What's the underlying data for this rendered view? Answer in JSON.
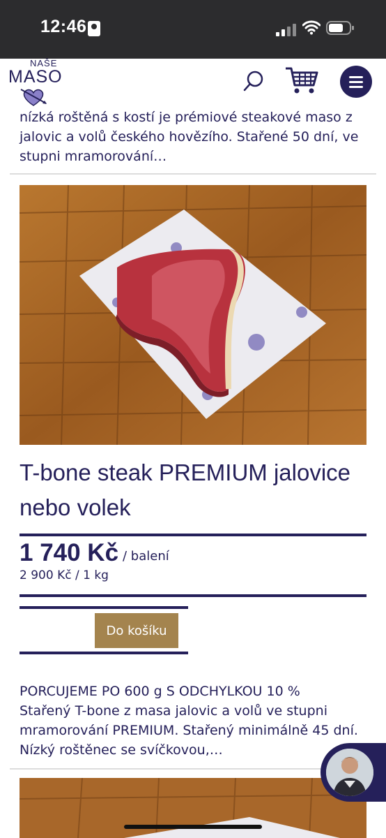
{
  "status_bar": {
    "time": "12:46"
  },
  "header": {
    "logo_small": "NAŠE",
    "logo_big": "MASO",
    "search_icon": "search-icon",
    "cart_icon": "cart-icon",
    "menu_icon": "hamburger-menu-icon",
    "brand_color": "#25205a"
  },
  "previous_item": {
    "description": "nízká roštěná s kostí je prémiové steakové maso z jalovic a volů českého hovězího. Stařené 50 dní, ve stupni mramorování…"
  },
  "product": {
    "title": "T-bone steak PREMIUM jalovice nebo volek",
    "price": "1 740 Kč",
    "per_unit": "/ balení",
    "unit_price": "2 900 Kč / 1 kg",
    "add_to_cart_label": "Do košíku",
    "button_color": "#a4844e",
    "description_heading": "PORCUJEME PO 600 g S ODCHYLKOU 10 %",
    "description": "Stařený T-bone z masa jalovic a volů ve stupni mramorování PREMIUM. Stařený minimálně 45 dní. Nízký roštěnec se svíčkovou,…"
  },
  "chat": {
    "icon": "chat-avatar"
  }
}
